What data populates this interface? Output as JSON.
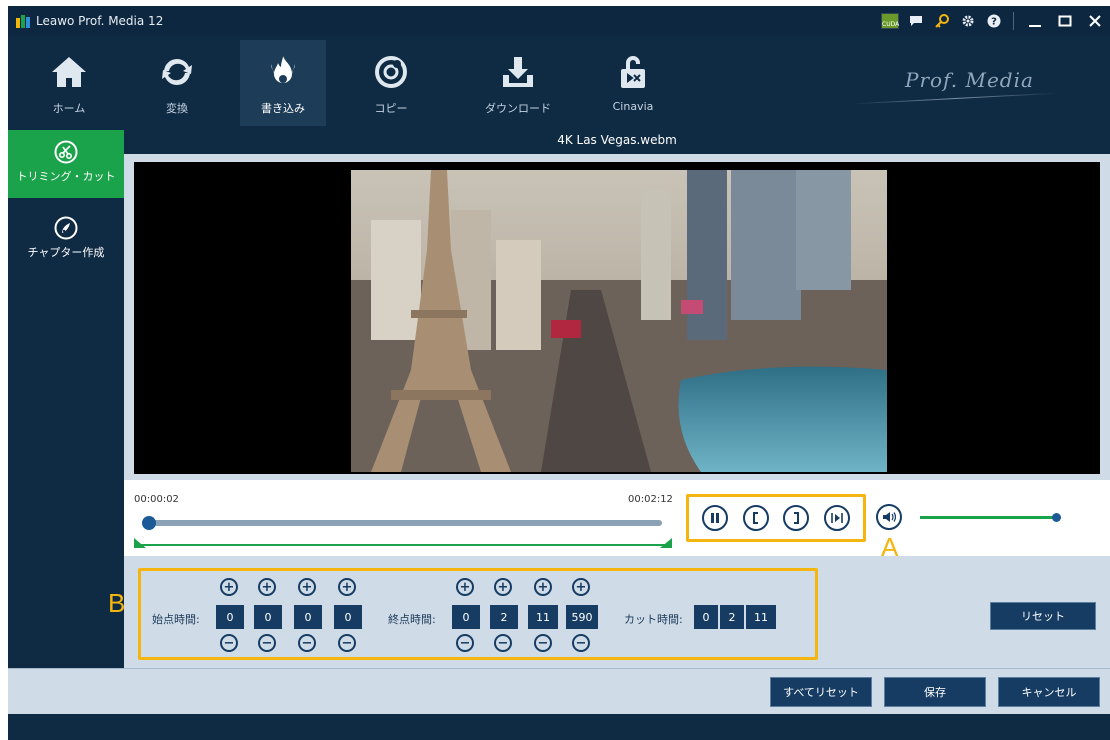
{
  "app": {
    "title": "Leawo Prof. Media 12"
  },
  "brand": "Prof. Media",
  "nav": {
    "items": [
      {
        "label": "ホーム",
        "icon": "home-icon"
      },
      {
        "label": "変換",
        "icon": "convert-icon"
      },
      {
        "label": "書き込み",
        "icon": "burn-icon"
      },
      {
        "label": "コピー",
        "icon": "disc-copy-icon"
      },
      {
        "label": "ダウンロード",
        "icon": "download-icon"
      },
      {
        "label": "Cinavia",
        "icon": "cinavia-lock-icon"
      }
    ],
    "active": "書き込み"
  },
  "sidebar": {
    "items": [
      {
        "label": "トリミング・カット",
        "icon": "scissors-icon"
      },
      {
        "label": "チャプター作成",
        "icon": "chapter-icon"
      }
    ]
  },
  "video": {
    "filename": "4K Las Vegas.webm"
  },
  "timeline": {
    "current": "00:00:02",
    "end": "00:02:12"
  },
  "annotations": {
    "a": "A",
    "b": "B"
  },
  "trim": {
    "start_label": "始点時間:",
    "start_values": [
      "0",
      "0",
      "0",
      "0"
    ],
    "end_label": "終点時間:",
    "end_values": [
      "0",
      "2",
      "11",
      "590"
    ],
    "cut_label": "カット時間:",
    "cut_values": [
      "0",
      "2",
      "11"
    ],
    "plus": "⊕",
    "minus": "⊖"
  },
  "buttons": {
    "reset": "リセット",
    "reset_all": "すべてリセット",
    "save": "保存",
    "cancel": "キャンセル"
  },
  "colors": {
    "accent_green": "#1aa34a",
    "dark_navy": "#0f2a43",
    "highlight_yellow": "#f5b50f"
  }
}
